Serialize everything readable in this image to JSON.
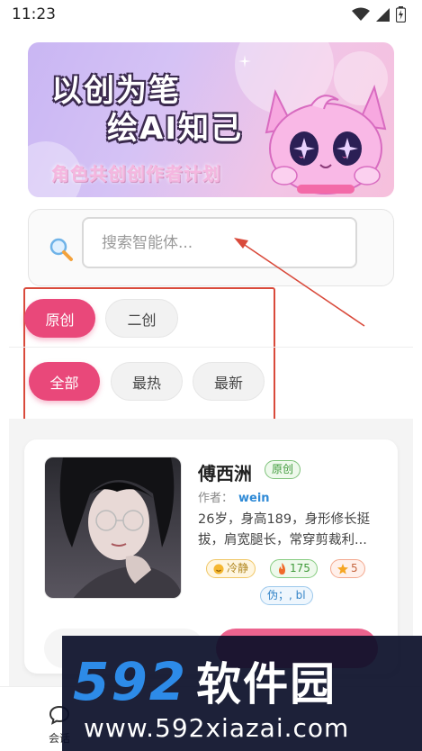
{
  "status_bar": {
    "time": "11:23"
  },
  "banner": {
    "title_line1": "以创为笔",
    "title_line2": "绘AI知己",
    "subtitle": "角色共创创作者计划"
  },
  "search": {
    "placeholder": "搜索智能体..."
  },
  "filters": {
    "source": [
      "原创",
      "二创"
    ],
    "source_selected": "原创",
    "sort": [
      "全部",
      "最热",
      "最新"
    ],
    "sort_selected": "全部"
  },
  "character": {
    "name": "傅西洲",
    "origin_tag": "原创",
    "author_label": "作者：",
    "author": "wein",
    "description": "26岁，身高189，身形修长挺拔，肩宽腿长，常穿剪裁利...",
    "mood": "冷静",
    "hot_count": "175",
    "star_count": "5",
    "tag": "伪；, bl"
  },
  "tabbar": {
    "chat_label": "会话"
  },
  "watermark": {
    "brand_num": "592",
    "brand_text": "软件园",
    "url": "www.592xiazai.com"
  },
  "colors": {
    "accent": "#e9487a",
    "annotation": "#d94a3b",
    "link": "#2f8ad6"
  }
}
